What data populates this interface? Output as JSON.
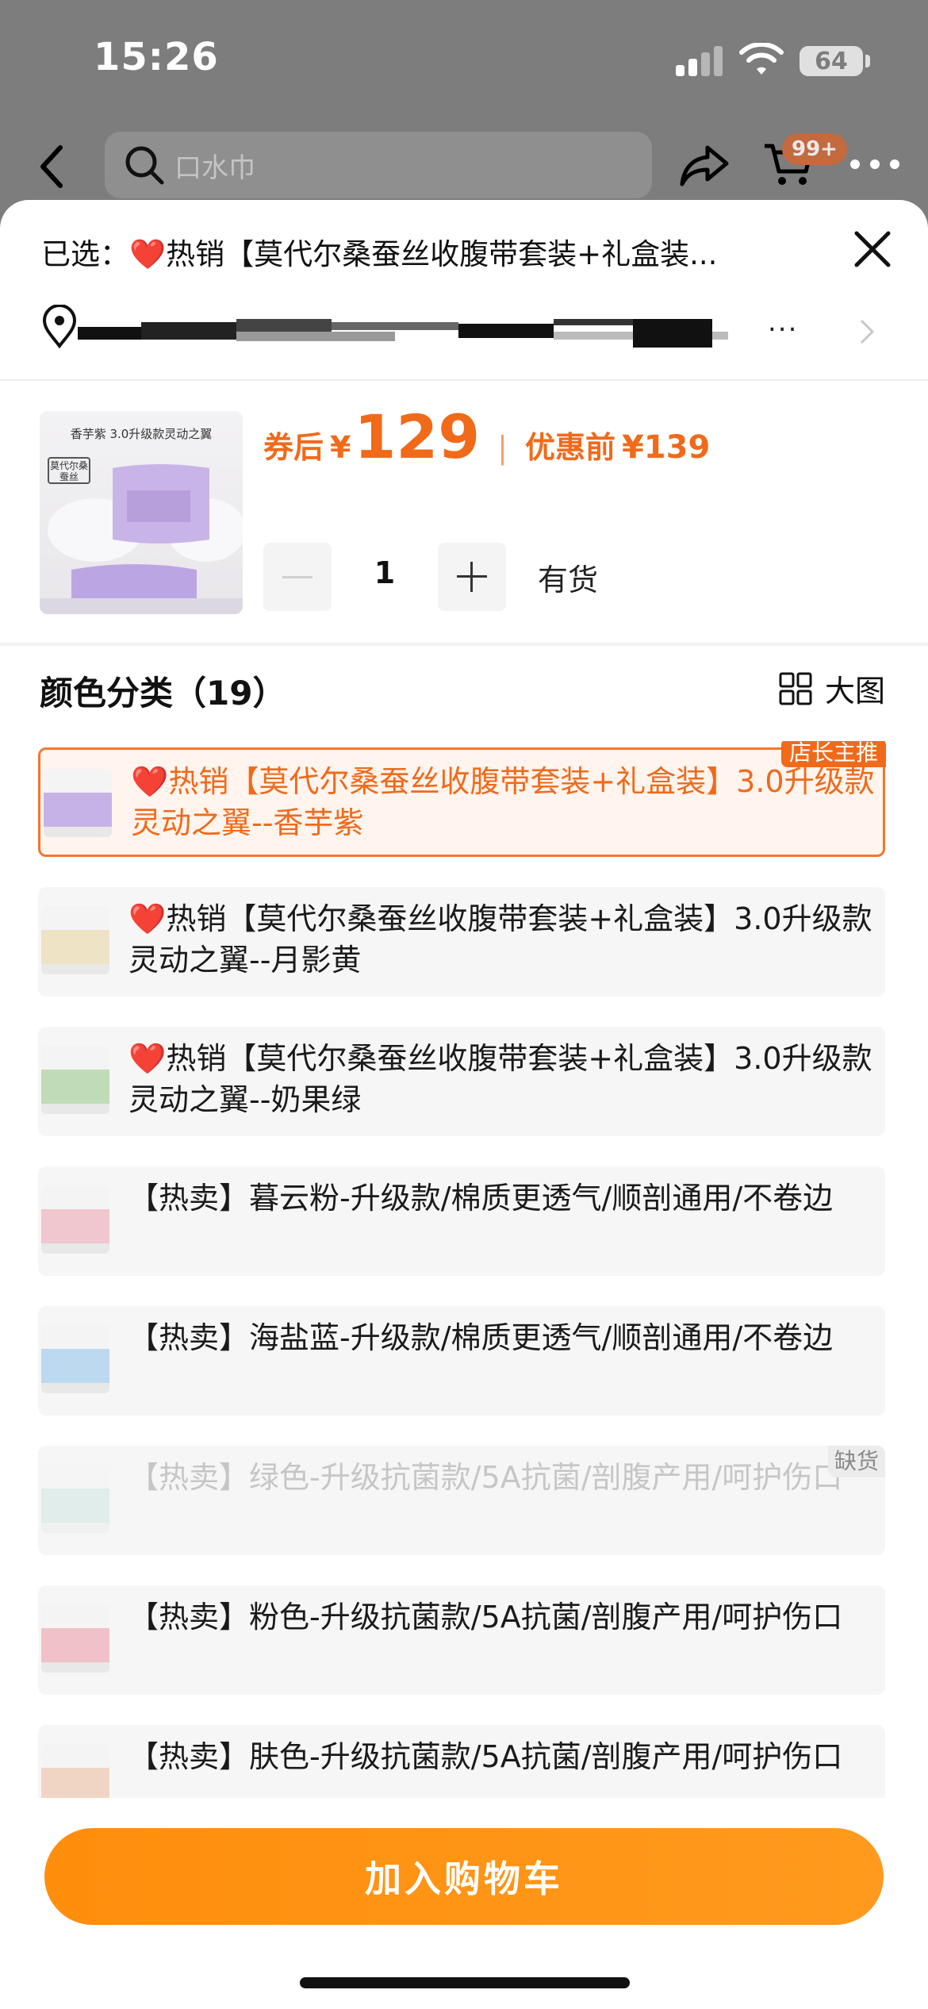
{
  "status_bar": {
    "time": "15:26",
    "battery": "64"
  },
  "nav": {
    "search_placeholder": "口水巾",
    "cart_badge": "99+"
  },
  "sheet": {
    "selected_label": "已选：❤️热销【莫代尔桑蚕丝收腹带套装+礼盒装...",
    "address_suffix": "...",
    "product": {
      "thumb_caption": "香芋紫 3.0升级款灵动之翼",
      "thumb_tag": "莫代尔桑蚕丝",
      "coupon_price_label": "券后",
      "currency": "¥",
      "coupon_price": "129",
      "separator": "|",
      "original_label": "优惠前",
      "original_price": "¥139"
    },
    "quantity": {
      "value": "1",
      "stock_status": "有货"
    },
    "category": {
      "title": "颜色分类（19）",
      "big_view_label": "大图"
    },
    "options": [
      {
        "text": "❤️热销【莫代尔桑蚕丝收腹带套装+礼盒装】3.0升级款灵动之翼--香芋紫",
        "badge": "店长主推",
        "state": "selected",
        "color": "#c7b2e6"
      },
      {
        "text": "❤️热销【莫代尔桑蚕丝收腹带套装+礼盒装】3.0升级款灵动之翼--月影黄",
        "state": "normal",
        "color": "#efe3c6"
      },
      {
        "text": "❤️热销【莫代尔桑蚕丝收腹带套装+礼盒装】3.0升级款灵动之翼--奶果绿",
        "state": "normal",
        "color": "#bfdcb7"
      },
      {
        "text": "【热卖】暮云粉-升级款/棉质更透气/顺剖通用/不卷边",
        "state": "normal",
        "color": "#f0c6cf"
      },
      {
        "text": "【热卖】海盐蓝-升级款/棉质更透气/顺剖通用/不卷边",
        "state": "normal",
        "color": "#bcd9ef"
      },
      {
        "text": "【热卖】绿色-升级抗菌款/5A抗菌/剖腹产用/呵护伤口",
        "state": "out_of_stock",
        "oos_label": "缺货",
        "color": "#bfe0d7"
      },
      {
        "text": "【热卖】粉色-升级抗菌款/5A抗菌/剖腹产用/呵护伤口",
        "state": "normal",
        "color": "#f1c1c9"
      },
      {
        "text": "【热卖】肤色-升级抗菌款/5A抗菌/剖腹产用/呵护伤口",
        "state": "normal",
        "color": "#f1d5c4"
      }
    ],
    "add_to_cart_label": "加入购物车"
  },
  "colors": {
    "accent": "#f06a1a",
    "button": "#ff9212",
    "backdrop": "#7d7d7d"
  }
}
